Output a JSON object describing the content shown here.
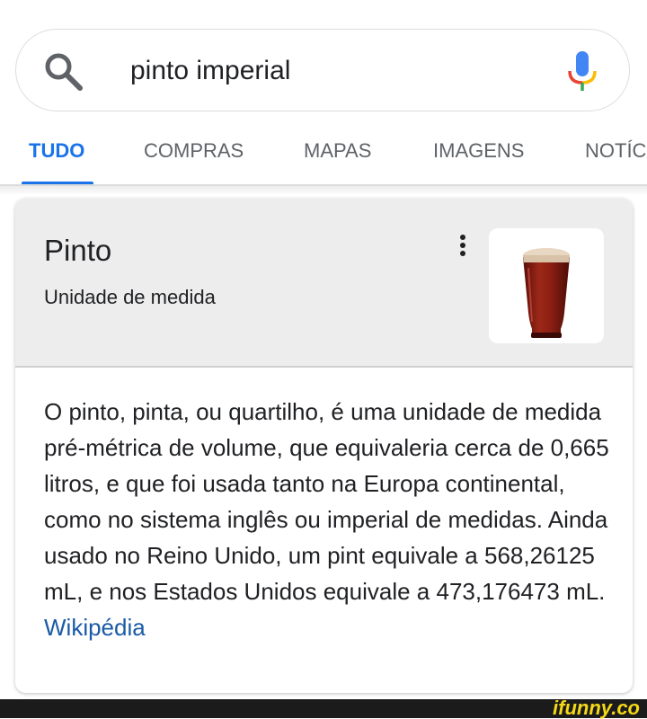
{
  "search": {
    "query": "pinto imperial",
    "icon": "search-icon",
    "mic_icon": "microphone-icon"
  },
  "tabs": [
    {
      "label": "TUDO",
      "active": true
    },
    {
      "label": "COMPRAS",
      "active": false
    },
    {
      "label": "MAPAS",
      "active": false
    },
    {
      "label": "IMAGENS",
      "active": false
    },
    {
      "label": "NOTÍC",
      "active": false
    }
  ],
  "knowledge_panel": {
    "title": "Pinto",
    "subtitle": "Unidade de medida",
    "more_icon": "more-vert-icon",
    "image": "pint-glass-beer-image",
    "description": "O pinto, pinta, ou quartilho, é uma unidade de medida pré-métrica de volume, que equivaleria cerca de 0,665 litros, e que foi usada tanto na Europa continental, como no sistema inglês ou imperial de medidas. Ainda usado no Reino Unido, um pint equivale a 568,26125 mL, e nos Estados Unidos equivale a 473,176473 mL.",
    "source_link": "Wikipédia"
  },
  "watermark": "ifunny.co",
  "colors": {
    "accent_blue": "#1a73e8",
    "link_blue": "#1a5aa6",
    "header_gray": "#ededed",
    "watermark_yellow": "#f5d816"
  }
}
